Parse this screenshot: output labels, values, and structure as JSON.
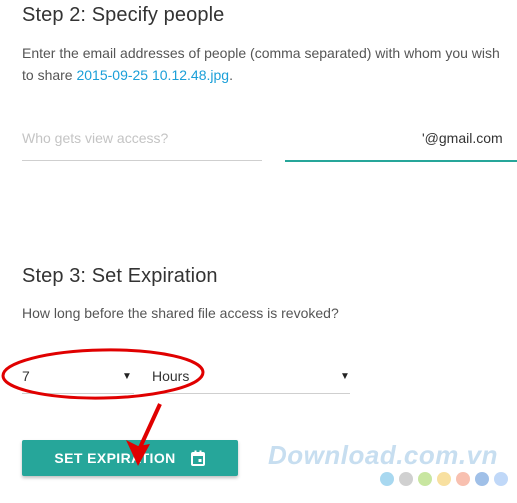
{
  "step2": {
    "title": "Step 2: Specify people",
    "description": "Enter the email addresses of people (comma separated) with whom you wish to share",
    "file_name": "2015-09-25 10.12.48.jpg",
    "file_suffix": ".",
    "view_placeholder": "Who gets view access?",
    "email_value": "'@gmail.com"
  },
  "step3": {
    "title": "Step 3: Set Expiration",
    "description": "How long before the shared file access is revoked?",
    "amount_selected": "7",
    "unit_selected": "Hours",
    "button_label": "SET EXPIRATION"
  },
  "watermark": {
    "text": "Download.com.vn",
    "dot_colors": [
      "#a8d8f0",
      "#d0d0d0",
      "#c8e6a0",
      "#f8e0a0",
      "#f8c0b0",
      "#a0c0e8",
      "#c0d8f8"
    ]
  },
  "annotation": {
    "ellipse_color": "#e00000",
    "arrow_color": "#e00000"
  }
}
